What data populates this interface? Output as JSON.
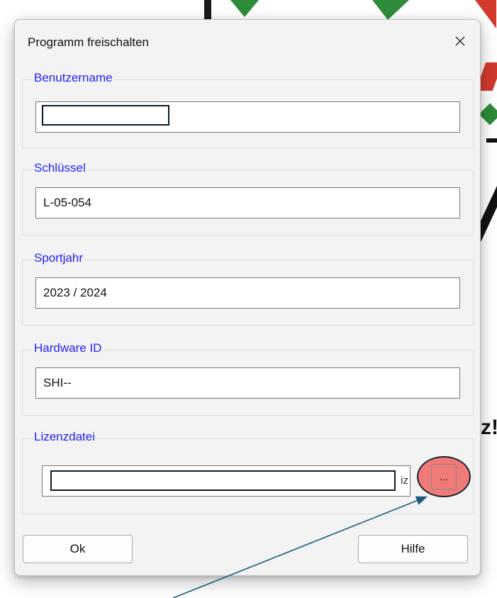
{
  "dialog": {
    "title": "Programm freischalten",
    "close_icon": "close-icon"
  },
  "groups": {
    "benutzername": {
      "label": "Benutzername",
      "value": ""
    },
    "schluessel": {
      "label": "Schlüssel",
      "value": "L-05-054"
    },
    "sportjahr": {
      "label": "Sportjahr",
      "value": "2023 / 2024"
    },
    "hardware_id": {
      "label": "Hardware ID",
      "value": "SHI--"
    },
    "lizenzdatei": {
      "label": "Lizenzdatei",
      "value_tail": "iz",
      "browse_label": "..."
    }
  },
  "buttons": {
    "ok": "Ok",
    "help": "Hilfe"
  },
  "background": {
    "partial_text": "z!"
  },
  "colors": {
    "group_label": "#1f1fff",
    "highlight": "#f07a78",
    "annotation_arrow": "#1e5a7a"
  }
}
